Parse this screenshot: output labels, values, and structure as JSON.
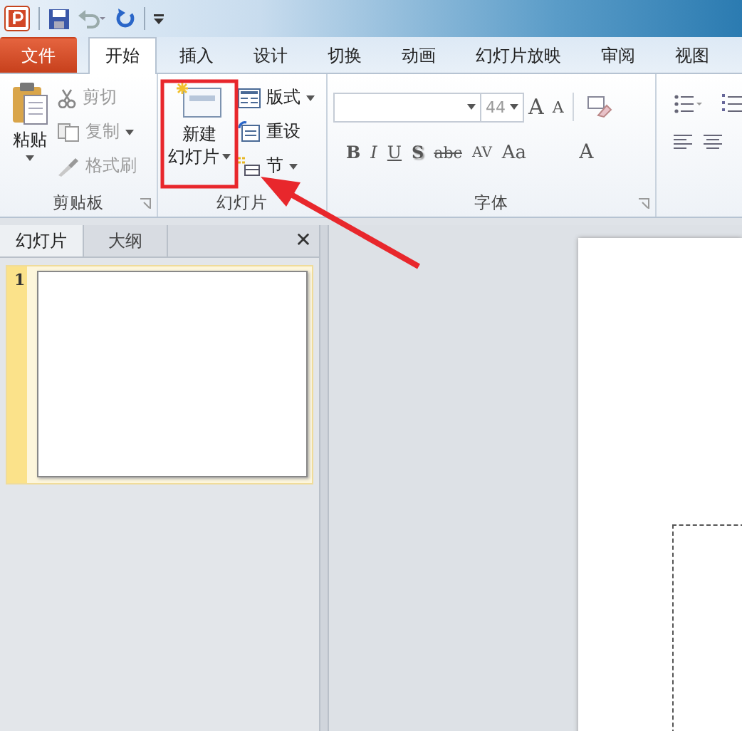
{
  "ribbon_tabs": [
    {
      "label": "文件",
      "kind": "file",
      "selected": false
    },
    {
      "label": "开始",
      "kind": "tab",
      "selected": true
    },
    {
      "label": "插入",
      "kind": "tab",
      "selected": false
    },
    {
      "label": "设计",
      "kind": "tab",
      "selected": false
    },
    {
      "label": "切换",
      "kind": "tab",
      "selected": false
    },
    {
      "label": "动画",
      "kind": "tab",
      "selected": false
    },
    {
      "label": "幻灯片放映",
      "kind": "tab",
      "selected": false
    },
    {
      "label": "审阅",
      "kind": "tab",
      "selected": false
    },
    {
      "label": "视图",
      "kind": "tab",
      "selected": false
    }
  ],
  "clipboard": {
    "label": "剪贴板",
    "paste": {
      "label": "粘贴",
      "disabled": false
    },
    "items": [
      {
        "label": "剪切",
        "kind": "cut",
        "disabled": true,
        "dropdown": false
      },
      {
        "label": "复制",
        "kind": "copy",
        "disabled": true,
        "dropdown": true
      },
      {
        "label": "格式刷",
        "kind": "brush",
        "disabled": true,
        "dropdown": false
      }
    ]
  },
  "slides_group": {
    "label": "幻灯片",
    "new_slide": {
      "lines": [
        "新建",
        "幻灯片"
      ]
    },
    "items": [
      {
        "label": "版式",
        "kind": "layout",
        "dropdown": true
      },
      {
        "label": "重设",
        "kind": "reset",
        "dropdown": false
      },
      {
        "label": "节",
        "kind": "section",
        "dropdown": true
      }
    ]
  },
  "font_group": {
    "label": "字体",
    "font_size": "44",
    "grow": "A",
    "shrink": "A",
    "format_buttons": [
      {
        "label": "B",
        "kind": "bold"
      },
      {
        "label": "I",
        "kind": "italic"
      },
      {
        "label": "U",
        "kind": "underline"
      },
      {
        "label": "S",
        "kind": "shadow"
      },
      {
        "label": "abc",
        "kind": "strike"
      },
      {
        "label": "AV",
        "kind": "spacing"
      },
      {
        "label": "Aa",
        "kind": "case"
      },
      {
        "label": "A",
        "kind": "color"
      }
    ]
  },
  "slide_pane": {
    "tabs": [
      {
        "label": "幻灯片",
        "selected": true
      },
      {
        "label": "大纲",
        "selected": false
      }
    ],
    "close": "✕",
    "thumbnails": [
      {
        "number": "1",
        "selected": true
      }
    ]
  }
}
